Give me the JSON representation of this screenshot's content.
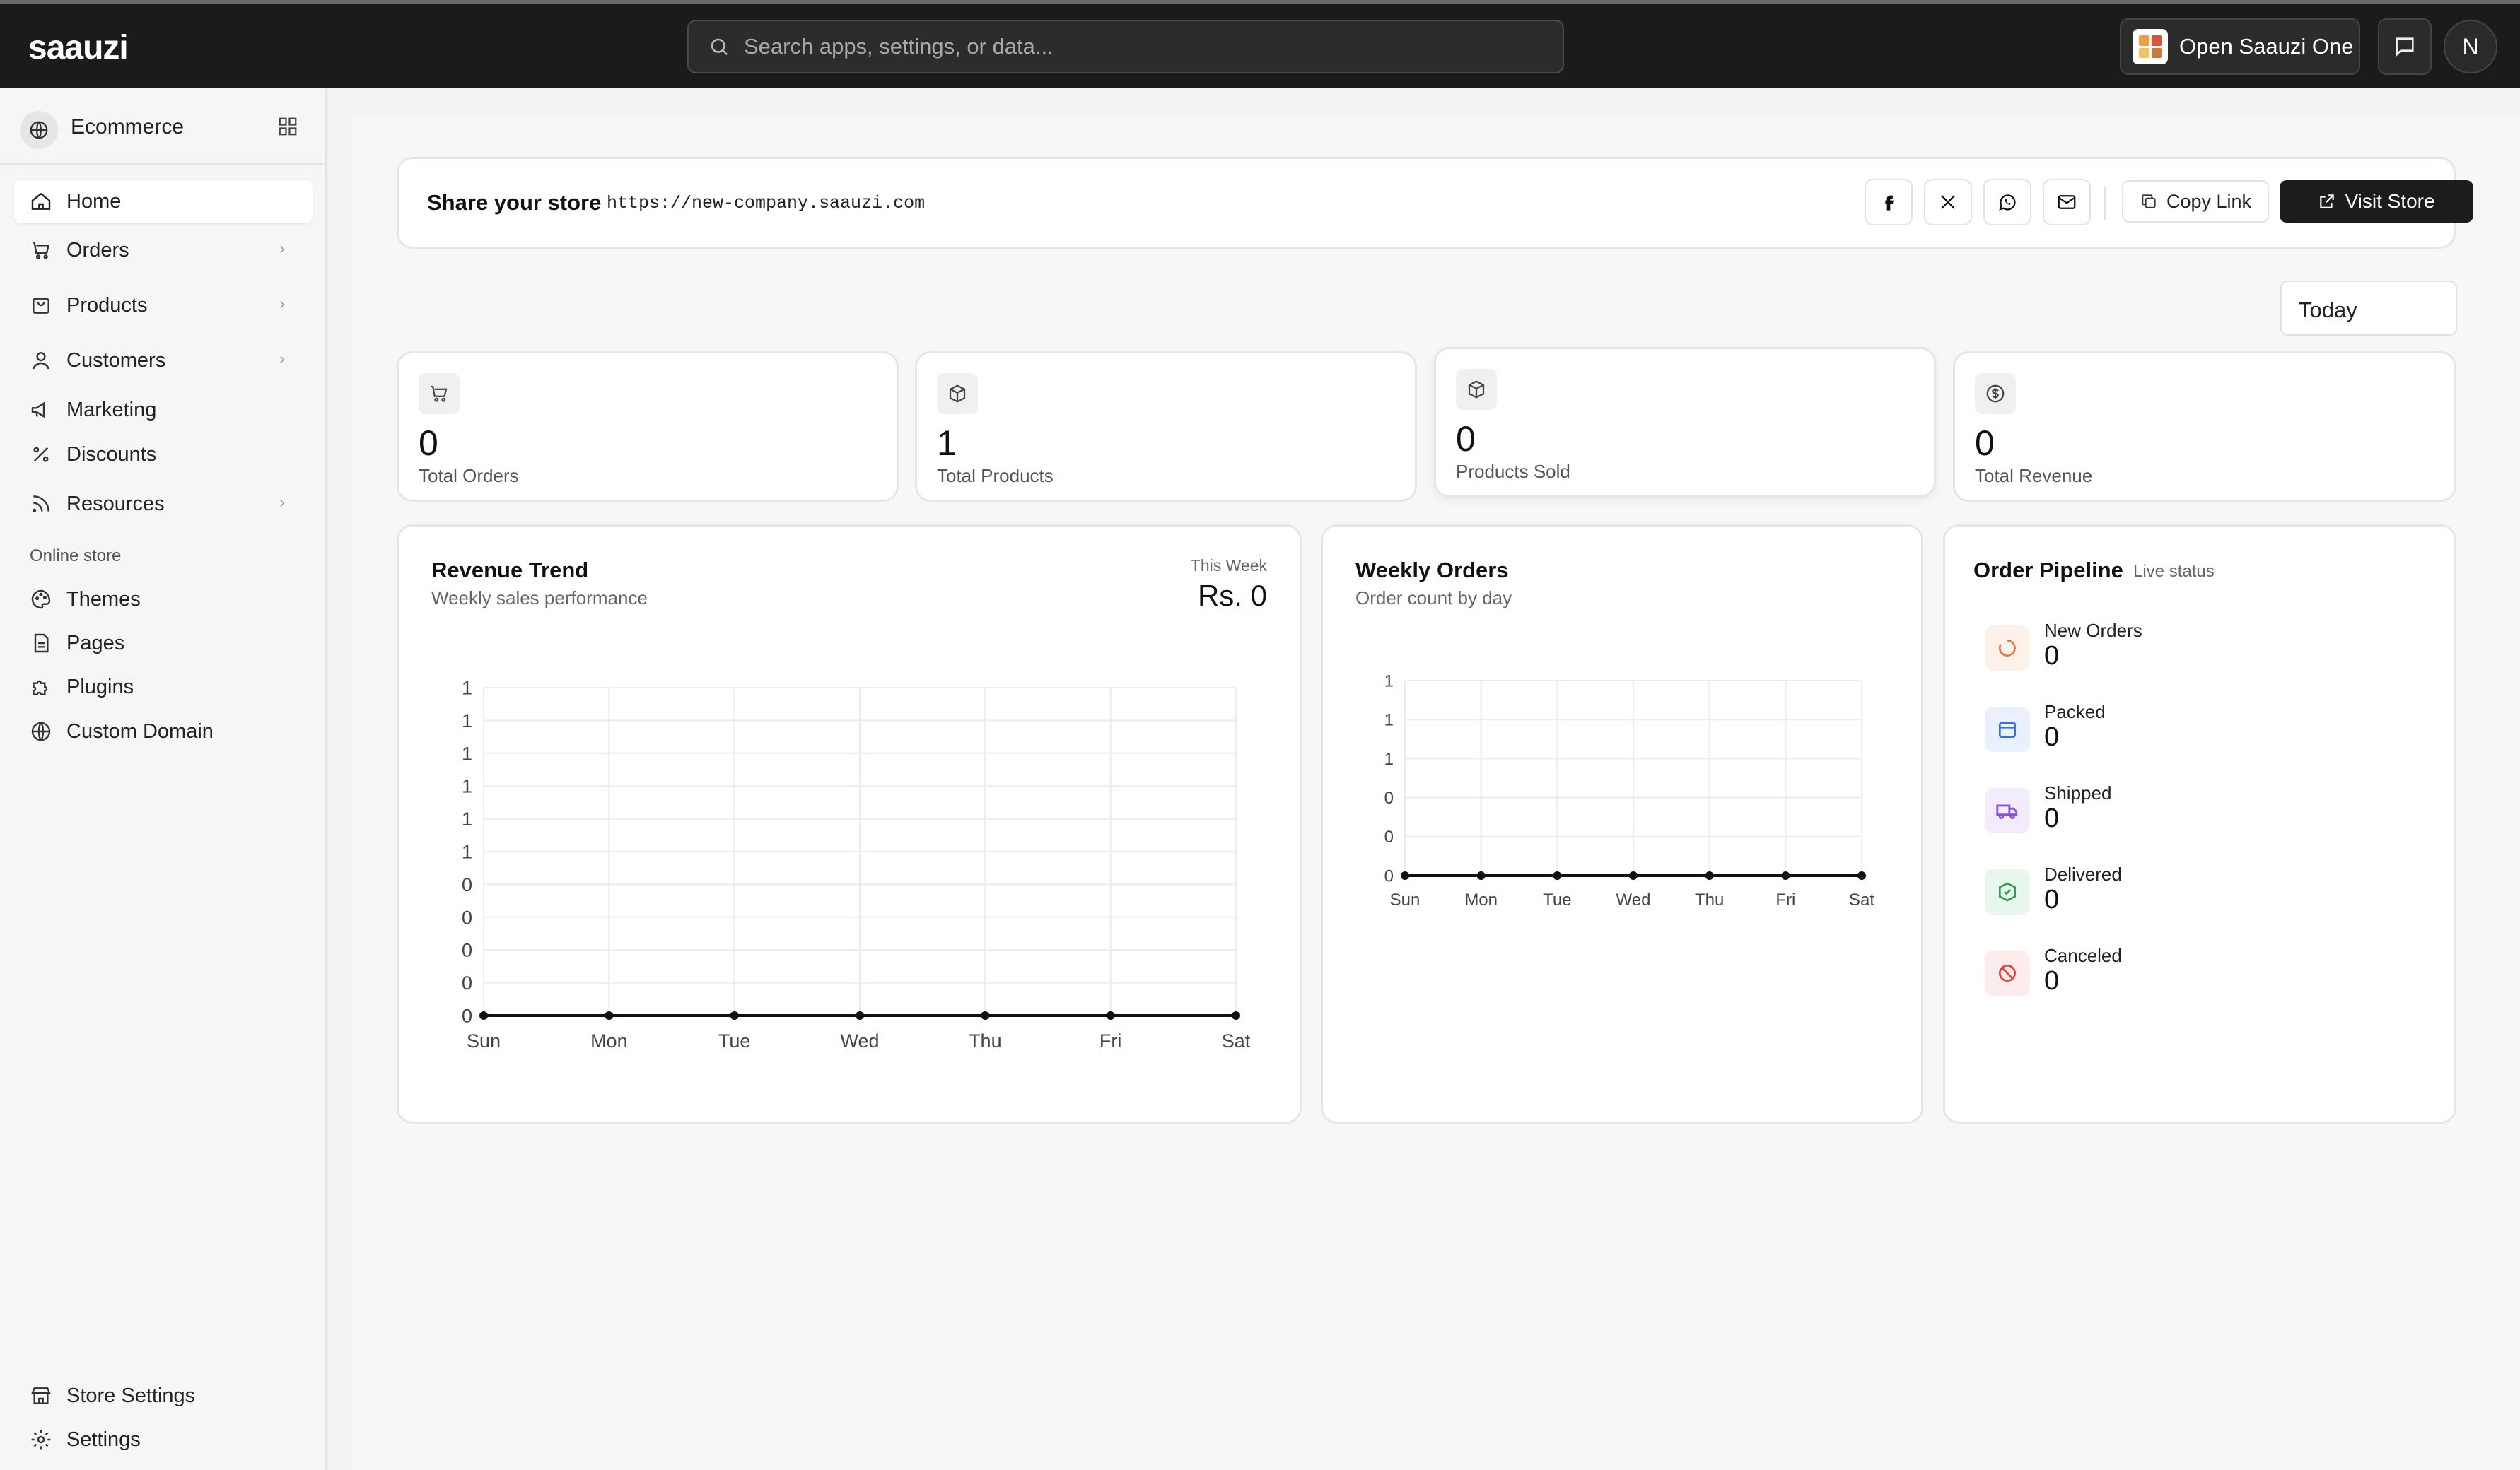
{
  "app": {
    "logo": "saauzi"
  },
  "search": {
    "placeholder": "Search apps, settings, or data..."
  },
  "header": {
    "open_button": "Open Saauzi One",
    "avatar_initial": "N"
  },
  "sidebar": {
    "workspace": "Ecommerce",
    "items": [
      {
        "label": "Home"
      },
      {
        "label": "Orders"
      },
      {
        "label": "Products"
      },
      {
        "label": "Customers"
      },
      {
        "label": "Marketing"
      },
      {
        "label": "Discounts"
      },
      {
        "label": "Resources"
      }
    ],
    "section_label": "Online store",
    "store_items": [
      {
        "label": "Themes"
      },
      {
        "label": "Pages"
      },
      {
        "label": "Plugins"
      },
      {
        "label": "Custom Domain"
      }
    ],
    "footer_items": [
      {
        "label": "Store Settings"
      },
      {
        "label": "Settings"
      }
    ]
  },
  "share": {
    "title": "Share your store",
    "url": "https://new-company.saauzi.com",
    "copy_label": "Copy Link",
    "visit_label": "Visit Store"
  },
  "period": {
    "selected": "Today"
  },
  "stats": [
    {
      "value": "0",
      "label": "Total Orders"
    },
    {
      "value": "1",
      "label": "Total Products"
    },
    {
      "value": "0",
      "label": "Products Sold"
    },
    {
      "value": "0",
      "label": "Total Revenue"
    }
  ],
  "revenue": {
    "title": "Revenue Trend",
    "subtitle": "Weekly sales performance",
    "period_label": "This Week",
    "total": "Rs. 0"
  },
  "weekly": {
    "title": "Weekly Orders",
    "subtitle": "Order count by day"
  },
  "pipeline": {
    "title": "Order Pipeline",
    "status": "Live status",
    "items": [
      {
        "label": "New Orders",
        "value": "0",
        "icon": "loader-icon"
      },
      {
        "label": "Packed",
        "value": "0",
        "icon": "package-icon"
      },
      {
        "label": "Shipped",
        "value": "0",
        "icon": "truck-icon"
      },
      {
        "label": "Delivered",
        "value": "0",
        "icon": "box-check-icon"
      },
      {
        "label": "Canceled",
        "value": "0",
        "icon": "ban-icon"
      }
    ]
  },
  "chart_data": [
    {
      "type": "line",
      "categories": [
        "Sun",
        "Mon",
        "Tue",
        "Wed",
        "Thu",
        "Fri",
        "Sat"
      ],
      "values": [
        0,
        0,
        0,
        0,
        0,
        0,
        0
      ],
      "ytick_labels": [
        "0",
        "0",
        "0",
        "0",
        "0",
        "1",
        "1",
        "1",
        "1",
        "1",
        "1"
      ],
      "ylim": [
        0,
        1
      ],
      "grid": true
    },
    {
      "type": "line",
      "categories": [
        "Sun",
        "Mon",
        "Tue",
        "Wed",
        "Thu",
        "Fri",
        "Sat"
      ],
      "values": [
        0,
        0,
        0,
        0,
        0,
        0,
        0
      ],
      "ytick_labels": [
        "0",
        "0",
        "0",
        "1",
        "1",
        "1"
      ],
      "ylim": [
        0,
        1
      ],
      "grid": true
    }
  ]
}
